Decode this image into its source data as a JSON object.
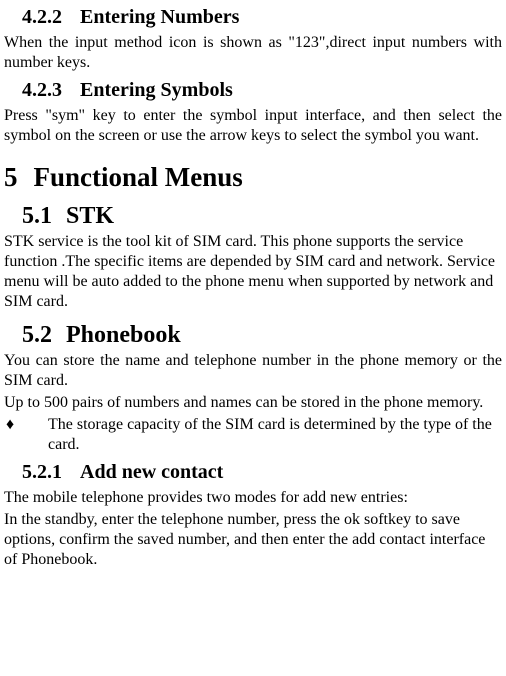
{
  "sec_422": {
    "num": "4.2.2",
    "title": "Entering Numbers",
    "body": "When the input method icon is shown as \"123\",direct input numbers  with number keys."
  },
  "sec_423": {
    "num": "4.2.3",
    "title": "Entering Symbols",
    "body": "Press \"sym\" key to enter the symbol input interface, and then select the symbol on the screen or use the arrow keys to select the symbol you want."
  },
  "sec_5": {
    "num": "5",
    "title": "Functional Menus"
  },
  "sec_51": {
    "num": "5.1",
    "title": "STK",
    "body": "STK service is the tool kit of SIM card. This phone supports the service function .The specific items are depended by SIM card and network. Service menu will be auto added to the phone menu when supported by network and SIM card."
  },
  "sec_52": {
    "num": "5.2",
    "title": "Phonebook",
    "body1": "You can store the name and telephone number in the phone memory or the SIM card.",
    "body2": "Up to 500 pairs of numbers and names can be stored in the phone memory.",
    "bullet_sym": "♦",
    "bullet_text": "The storage capacity of the SIM card is determined by the type of the card."
  },
  "sec_521": {
    "num": "5.2.1",
    "title": "Add new contact",
    "body1": "The mobile telephone provides two modes for add new entries:",
    "body2": "In the standby, enter the telephone number, press the ok softkey to save options, confirm the saved number, and then enter the add contact interface of Phonebook."
  }
}
